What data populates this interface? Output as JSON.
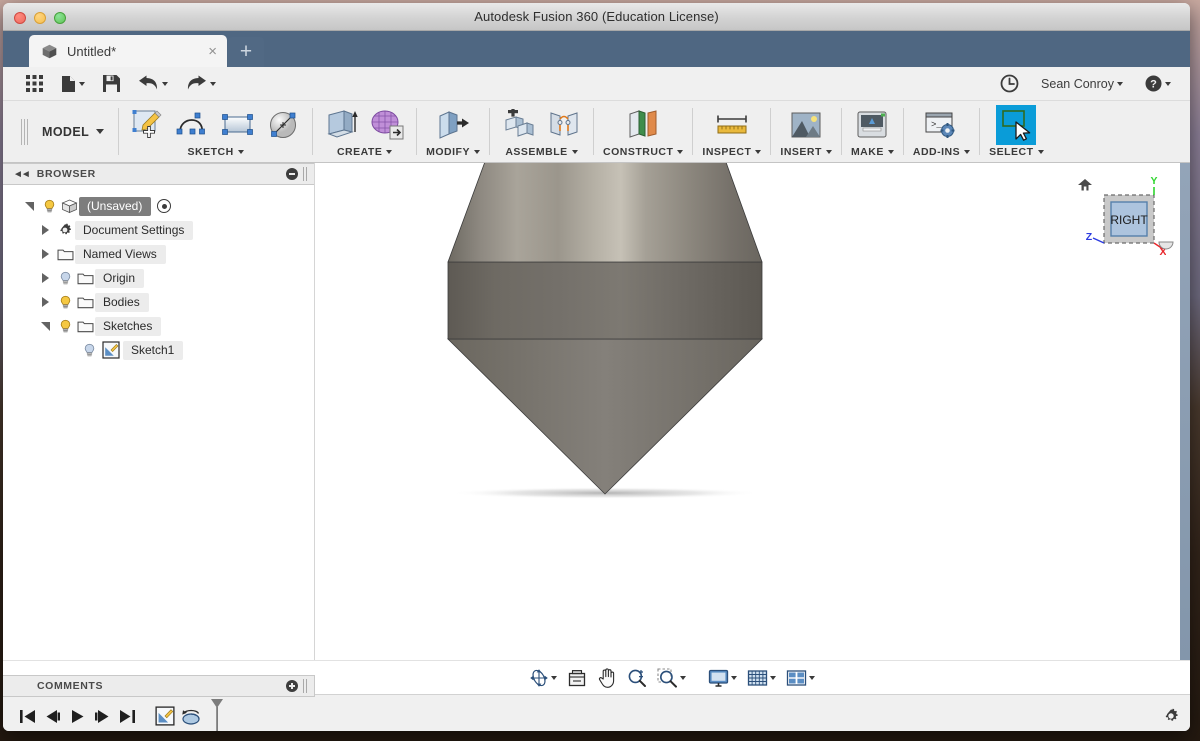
{
  "window": {
    "title": "Autodesk Fusion 360 (Education License)"
  },
  "tabs": {
    "document_tab_label": "Untitled*",
    "close_label": "×",
    "new_tab_label": "+"
  },
  "quick_access": {
    "grid_icon": "app-grid-icon",
    "new_icon": "new-document-icon",
    "save_icon": "save-icon",
    "undo_icon": "undo-icon",
    "redo_icon": "redo-icon",
    "history_icon": "recent-history-icon",
    "user_name": "Sean Conroy",
    "help_icon": "help-icon"
  },
  "ribbon": {
    "workspace_label": "MODEL",
    "groups": [
      {
        "label": "SKETCH",
        "icons": [
          "create-sketch-icon",
          "spline-icon",
          "rectangle-icon",
          "circle-icon"
        ]
      },
      {
        "label": "CREATE",
        "icons": [
          "extrude-icon",
          "form-icon"
        ]
      },
      {
        "label": "MODIFY",
        "icons": [
          "press-pull-icon"
        ]
      },
      {
        "label": "ASSEMBLE",
        "icons": [
          "new-component-icon",
          "joint-icon"
        ]
      },
      {
        "label": "CONSTRUCT",
        "icons": [
          "offset-plane-icon"
        ]
      },
      {
        "label": "INSPECT",
        "icons": [
          "measure-icon"
        ]
      },
      {
        "label": "INSERT",
        "icons": [
          "insert-image-icon"
        ]
      },
      {
        "label": "MAKE",
        "icons": [
          "3d-print-icon"
        ]
      },
      {
        "label": "ADD-INS",
        "icons": [
          "scripts-addins-icon"
        ]
      },
      {
        "label": "SELECT",
        "icons": [
          "select-icon"
        ]
      }
    ]
  },
  "browser": {
    "title": "BROWSER",
    "collapse_icon": "collapse-left-icon",
    "minimize_icon": "minimize-icon",
    "tree": [
      {
        "label": "(Unsaved)",
        "indent": 0,
        "toggle": "open",
        "bulb": "on",
        "icon": "component-icon",
        "target": true
      },
      {
        "label": "Document Settings",
        "indent": 1,
        "toggle": "closed",
        "bulb": "none",
        "icon": "gear-icon"
      },
      {
        "label": "Named Views",
        "indent": 1,
        "toggle": "closed",
        "bulb": "none",
        "icon": "folder-icon"
      },
      {
        "label": "Origin",
        "indent": 1,
        "toggle": "closed",
        "bulb": "off",
        "icon": "folder-icon"
      },
      {
        "label": "Bodies",
        "indent": 1,
        "toggle": "closed",
        "bulb": "on",
        "icon": "folder-icon"
      },
      {
        "label": "Sketches",
        "indent": 1,
        "toggle": "open",
        "bulb": "on",
        "icon": "folder-icon"
      },
      {
        "label": "Sketch1",
        "indent": 2,
        "toggle": "none",
        "bulb": "off",
        "icon": "sketch-icon"
      }
    ]
  },
  "comments": {
    "title": "COMMENTS",
    "add_icon": "add-comment-icon"
  },
  "viewcube": {
    "face_label": "RIGHT",
    "home_icon": "home-icon",
    "axis_x": "X",
    "axis_y": "Y",
    "axis_z": "Z",
    "axis_x_color": "#e8252a",
    "axis_y_color": "#2fd62f",
    "axis_z_color": "#2b3ae0"
  },
  "nav_bar": {
    "buttons": [
      {
        "name": "orbit-icon",
        "has_caret": true
      },
      {
        "name": "look-at-icon",
        "has_caret": false
      },
      {
        "name": "pan-icon",
        "has_caret": false
      },
      {
        "name": "zoom-icon",
        "has_caret": false
      },
      {
        "name": "zoom-window-icon",
        "has_caret": true
      },
      {
        "name": "display-settings-icon",
        "has_caret": true
      },
      {
        "name": "grid-snaps-icon",
        "has_caret": true
      },
      {
        "name": "viewports-icon",
        "has_caret": true
      }
    ]
  },
  "timeline": {
    "controls": [
      {
        "name": "jump-to-beginning-button",
        "glyph": "skip-back"
      },
      {
        "name": "step-back-button",
        "glyph": "step-back"
      },
      {
        "name": "play-button",
        "glyph": "play"
      },
      {
        "name": "step-forward-button",
        "glyph": "step-forward"
      },
      {
        "name": "jump-to-end-button",
        "glyph": "skip-end"
      }
    ],
    "features": [
      {
        "name": "timeline-feature-sketch1",
        "icon": "sketch-icon"
      },
      {
        "name": "timeline-feature-revolve",
        "icon": "revolve-icon"
      }
    ],
    "marker_name": "timeline-end-marker",
    "settings_icon": "settings-gear-icon"
  },
  "model": {
    "name": "revolved-solid-body",
    "description": "Shaded revolved polygonal solid in the 3D viewport",
    "appearance": "steel-gray-metal"
  },
  "colors": {
    "tab_strip": "#4f6782",
    "ribbon_bg": "#efefef",
    "panel_bg": "#ececec",
    "canvas_bg": "#ffffff",
    "select_highlight": "#0a9cd8",
    "row_highlight": "#7d7d7d"
  }
}
